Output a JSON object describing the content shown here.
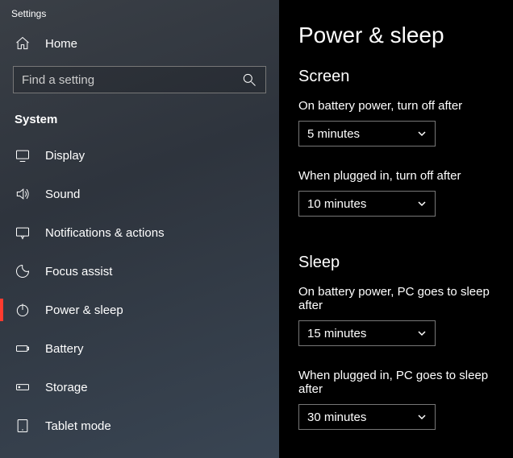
{
  "window_title": "Settings",
  "home_label": "Home",
  "search": {
    "placeholder": "Find a setting"
  },
  "category": "System",
  "nav": {
    "display": "Display",
    "sound": "Sound",
    "notifications": "Notifications & actions",
    "focus": "Focus assist",
    "power": "Power & sleep",
    "battery": "Battery",
    "storage": "Storage",
    "tablet": "Tablet mode"
  },
  "page": {
    "title": "Power & sleep",
    "screen": {
      "heading": "Screen",
      "battery_label": "On battery power, turn off after",
      "battery_value": "5 minutes",
      "plugged_label": "When plugged in, turn off after",
      "plugged_value": "10 minutes"
    },
    "sleep": {
      "heading": "Sleep",
      "battery_label": "On battery power, PC goes to sleep after",
      "battery_value": "15 minutes",
      "plugged_label": "When plugged in, PC goes to sleep after",
      "plugged_value": "30 minutes"
    }
  }
}
